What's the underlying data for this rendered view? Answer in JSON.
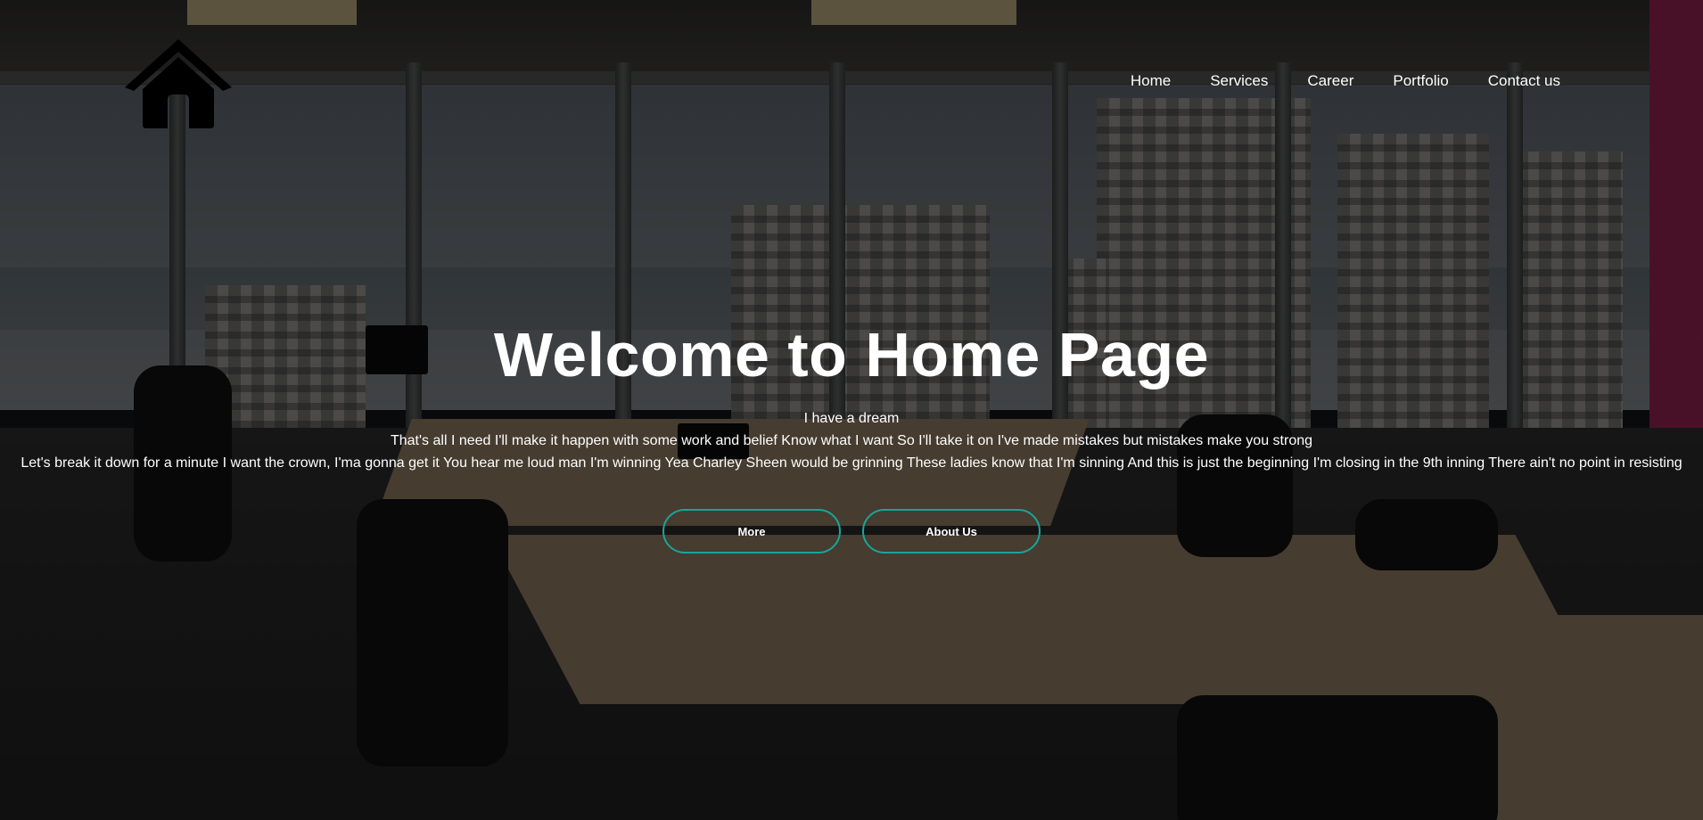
{
  "header": {
    "logo_icon": "home-icon",
    "nav": [
      {
        "label": "Home"
      },
      {
        "label": "Services"
      },
      {
        "label": "Career"
      },
      {
        "label": "Portfolio"
      },
      {
        "label": "Contact us"
      }
    ]
  },
  "hero": {
    "title": "Welcome to Home Page",
    "lines": [
      "I have a dream",
      "That's all I need I'll make it happen with some work and belief Know what I want So I'll take it on I've made mistakes but mistakes make you strong",
      "Let's break it down for a minute I want the crown, I'ma gonna get it You hear me loud man I'm winning Yea Charley Sheen would be grinning These ladies know that I'm sinning And this is just the beginning I'm closing in the 9th inning There ain't no point in resisting"
    ],
    "buttons": {
      "more": "More",
      "about": "About Us"
    }
  },
  "colors": {
    "accent": "#1aa597",
    "text": "#ffffff",
    "overlay": "rgba(0,0,0,0.62)"
  }
}
